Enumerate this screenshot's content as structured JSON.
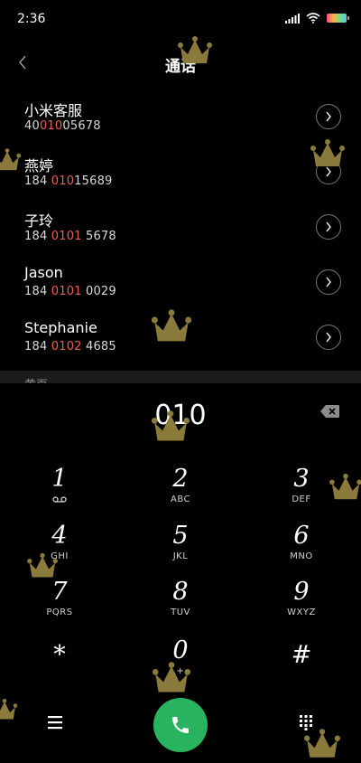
{
  "status_bar": {
    "time": "2:36",
    "icons": [
      "signal-icon",
      "wifi-icon",
      "battery-icon"
    ]
  },
  "header": {
    "title": "通话",
    "back_icon": "chevron-left-icon"
  },
  "results": [
    {
      "name": "小米客服",
      "number_pre": "40",
      "number_match": "010",
      "number_post": "05678"
    },
    {
      "name": "燕婷",
      "number_pre": "184 ",
      "number_match": "010",
      "number_post": "15689"
    },
    {
      "name": "子玲",
      "number_pre": "184 ",
      "number_match": "0101",
      "number_post": " 5678"
    },
    {
      "name": "Jason",
      "number_pre": "184 ",
      "number_match": "0101",
      "number_post": " 0029"
    },
    {
      "name": "Stephanie",
      "number_pre": "184 ",
      "number_match": "0102",
      "number_post": " 4685"
    }
  ],
  "section_header": "黄页",
  "dialer": {
    "number": "010",
    "keys": [
      {
        "digit": "1",
        "letters": ""
      },
      {
        "digit": "2",
        "letters": "ABC"
      },
      {
        "digit": "3",
        "letters": "DEF"
      },
      {
        "digit": "4",
        "letters": "GHI"
      },
      {
        "digit": "5",
        "letters": "JKL"
      },
      {
        "digit": "6",
        "letters": "MNO"
      },
      {
        "digit": "7",
        "letters": "PQRS"
      },
      {
        "digit": "8",
        "letters": "TUV"
      },
      {
        "digit": "9",
        "letters": "WXYZ"
      },
      {
        "digit": "*",
        "letters": ""
      },
      {
        "digit": "0",
        "letters": "+"
      },
      {
        "digit": "#",
        "letters": ""
      }
    ]
  },
  "colors": {
    "background": "#000000",
    "highlight": "#e9624a",
    "call_button": "#29b35f",
    "crown_sticker": "#8a7a3c"
  },
  "icons": {
    "backspace": "backspace-icon",
    "menu": "menu-icon",
    "call": "phone-icon",
    "keypad": "keypad-icon",
    "detail": "chevron-right-icon",
    "voicemail": "voicemail-icon",
    "decoration": "crown-icon"
  }
}
